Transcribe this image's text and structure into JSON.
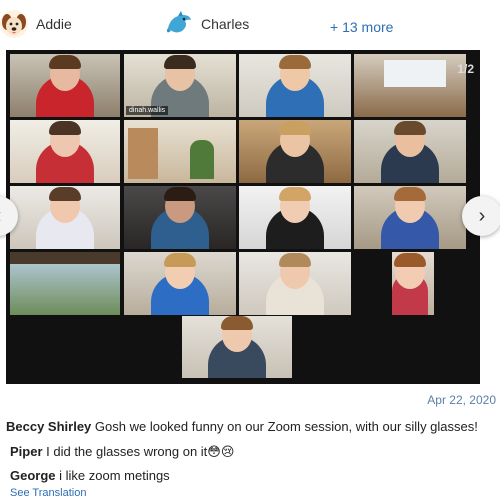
{
  "header": {
    "members": [
      {
        "name": "Addie",
        "icon": "dog-avatar-icon"
      },
      {
        "name": "Charles",
        "icon": "dolphin-avatar-icon"
      }
    ],
    "more_label": "+ 13 more"
  },
  "gallery": {
    "page_indicator": "1/2",
    "active_name_tag": "dinah.wallis"
  },
  "post": {
    "date": "Apr 22, 2020",
    "comments": [
      {
        "author": "Beccy Shirley",
        "text": "Gosh we looked funny on our Zoom session, with our silly glasses!"
      },
      {
        "author": "Piper",
        "text": "I did the glasses wrong on it😳😢"
      },
      {
        "author": "George",
        "text": "i like zoom metings"
      }
    ],
    "see_translation": "See Translation"
  }
}
